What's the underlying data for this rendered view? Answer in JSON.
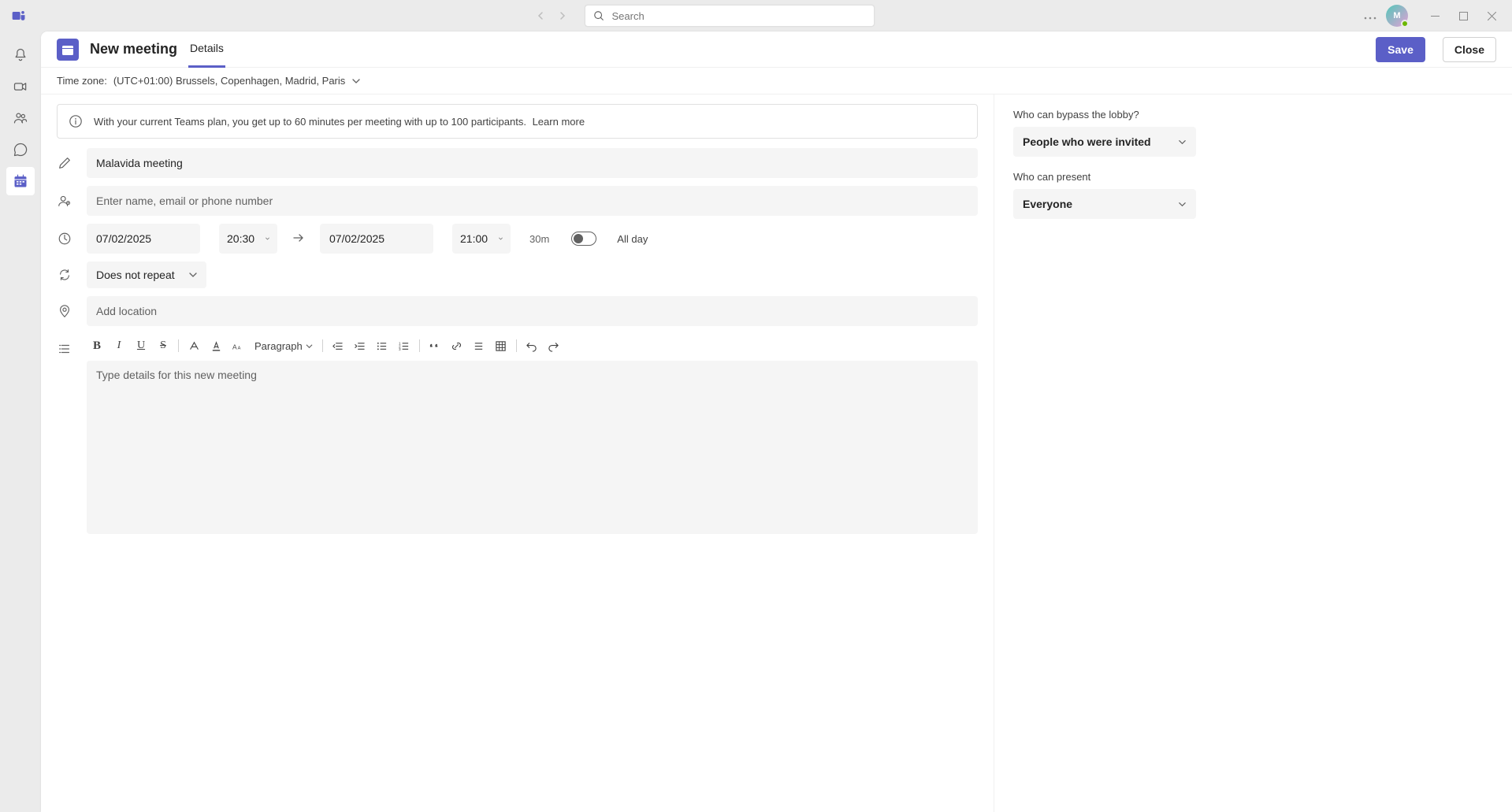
{
  "titlebar": {
    "search_placeholder": "Search"
  },
  "rail": {
    "items": [
      "activity",
      "meet",
      "community",
      "chat",
      "calendar"
    ]
  },
  "header": {
    "title": "New meeting",
    "tab_details": "Details",
    "save_label": "Save",
    "close_label": "Close"
  },
  "timezone": {
    "label": "Time zone:",
    "value": "(UTC+01:00) Brussels, Copenhagen, Madrid, Paris"
  },
  "banner": {
    "text": "With your current Teams plan, you get up to 60 minutes per meeting with up to 100 participants.",
    "learn_more": "Learn more"
  },
  "form": {
    "title_value": "Malavida meeting",
    "attendees_placeholder": "Enter name, email or phone number",
    "start_date": "07/02/2025",
    "start_time": "20:30",
    "end_date": "07/02/2025",
    "end_time": "21:00",
    "duration": "30m",
    "all_day_label": "All day",
    "repeat_value": "Does not repeat",
    "location_placeholder": "Add location",
    "paragraph_label": "Paragraph",
    "details_placeholder": "Type details for this new meeting"
  },
  "options": {
    "bypass_label": "Who can bypass the lobby?",
    "bypass_value": "People who were invited",
    "present_label": "Who can present",
    "present_value": "Everyone"
  }
}
